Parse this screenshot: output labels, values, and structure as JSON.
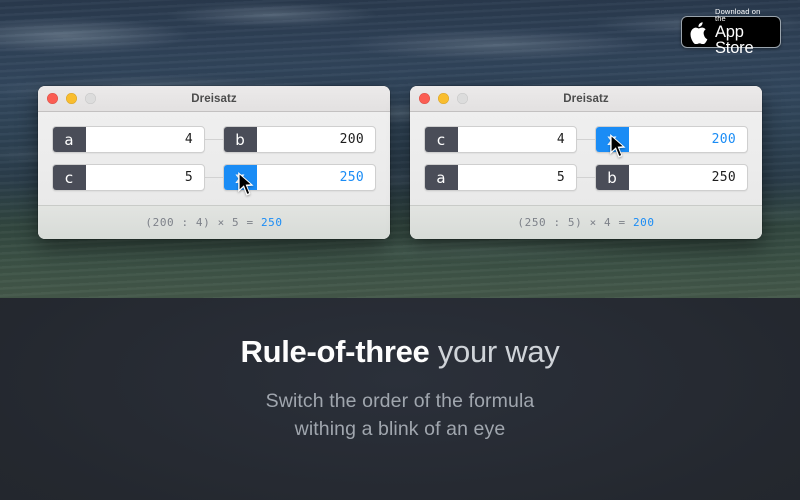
{
  "colors": {
    "accent_blue": "#1a8cf5",
    "tag_dark": "#4a4d58",
    "panel_dark": "#24282f",
    "window_body": "#ececec",
    "headline": "#fdfdfd",
    "subline": "#a0a6ae"
  },
  "app_store_badge": {
    "small_label": "Download on the",
    "big_label": "App Store",
    "icon": "apple-logo-icon"
  },
  "windows": [
    {
      "title": "Dreisatz",
      "traffic_lights": [
        "close-button",
        "minimize-button",
        "zoom-button"
      ],
      "rows": [
        {
          "left": {
            "tag": "a",
            "value": "4",
            "solve": false
          },
          "right": {
            "tag": "b",
            "value": "200",
            "solve": false
          }
        },
        {
          "left": {
            "tag": "c",
            "value": "5",
            "solve": false
          },
          "right": {
            "tag": "x",
            "value": "250",
            "solve": true
          }
        }
      ],
      "formula": {
        "expression": "(200 : 4) × 5 = ",
        "result": "250"
      },
      "cursor_on": "x-field-row2"
    },
    {
      "title": "Dreisatz",
      "traffic_lights": [
        "close-button",
        "minimize-button",
        "zoom-button"
      ],
      "rows": [
        {
          "left": {
            "tag": "c",
            "value": "4",
            "solve": false
          },
          "right": {
            "tag": "x",
            "value": "200",
            "solve": true
          }
        },
        {
          "left": {
            "tag": "a",
            "value": "5",
            "solve": false
          },
          "right": {
            "tag": "b",
            "value": "250",
            "solve": false
          }
        }
      ],
      "formula": {
        "expression": "(250 : 5) × 4 = ",
        "result": "200"
      },
      "cursor_on": "x-field-row1"
    }
  ],
  "marketing": {
    "headline_bold": "Rule-of-three",
    "headline_rest": " your way",
    "subline_line1": "Switch the order of the formula",
    "subline_line2": "withing a blink of an eye"
  }
}
